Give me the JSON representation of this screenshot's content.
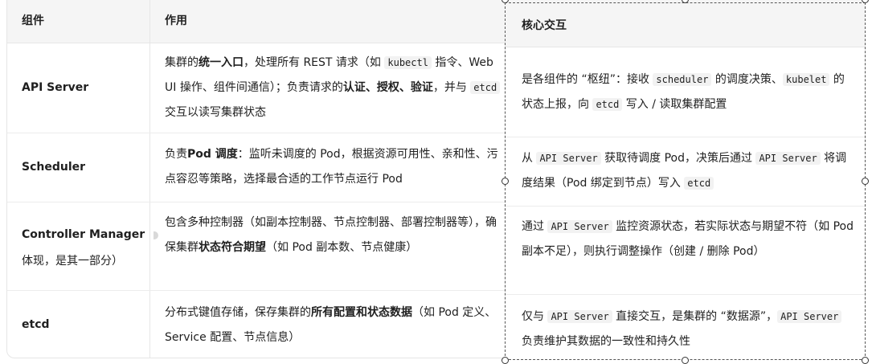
{
  "headers": {
    "component": "组件",
    "role": "作用",
    "interaction": "核心交互"
  },
  "rows": [
    {
      "name": "API Server",
      "desc": [
        {
          "t": "集群的"
        },
        {
          "b": "统一入口"
        },
        {
          "t": "，处理所有 REST 请求（如 "
        },
        {
          "c": "kubectl"
        },
        {
          "t": " 指令、Web UI 操作、组件间通信）；负责请求的"
        },
        {
          "b": "认证、授权、验证"
        },
        {
          "t": "，并与 "
        },
        {
          "c": "etcd"
        },
        {
          "t": " 交互以读写集群状态"
        }
      ],
      "interaction": [
        {
          "t": "是各组件的 “枢纽”：接收 "
        },
        {
          "c": "scheduler"
        },
        {
          "t": " 的调度决策、"
        },
        {
          "c": "kubelet"
        },
        {
          "t": " 的状态上报，向 "
        },
        {
          "c": "etcd"
        },
        {
          "t": " 写入 / 读取集群配置"
        }
      ]
    },
    {
      "name": "Scheduler",
      "desc": [
        {
          "t": "负责"
        },
        {
          "b": "Pod 调度"
        },
        {
          "t": "：监听未调度的 Pod，根据资源可用性、亲和性、污点容忍等策略，选择最合适的工作节点运行 Pod"
        }
      ],
      "interaction": [
        {
          "t": "从 "
        },
        {
          "c": "API Server"
        },
        {
          "t": " 获取待调度 Pod，决策后通过 "
        },
        {
          "c": "API Server"
        },
        {
          "t": " 将调度结果（Pod 绑定到节点）写入 "
        },
        {
          "c": "etcd"
        }
      ]
    },
    {
      "name": "Controller Manager",
      "sub": "体现，是其一部分）",
      "desc": [
        {
          "t": "包含多种控制器（如副本控制器、节点控制器、部署控制器等），确保集群"
        },
        {
          "b": "状态符合期望"
        },
        {
          "t": "（如 Pod 副本数、节点健康）"
        }
      ],
      "interaction": [
        {
          "t": "通过 "
        },
        {
          "c": "API Server"
        },
        {
          "t": " 监控资源状态，若实际状态与期望不符（如 Pod 副本不足），则执行调整操作（创建 / 删除 Pod）"
        }
      ]
    },
    {
      "name": "etcd",
      "desc": [
        {
          "t": "分布式键值存储，保存集群的"
        },
        {
          "b": "所有配置和状态数据"
        },
        {
          "t": "（如 Pod 定义、Service 配置、节点信息）"
        }
      ],
      "interaction": [
        {
          "t": "仅与 "
        },
        {
          "c": "API Server"
        },
        {
          "t": " 直接交互，是集群的 “数据源”，"
        },
        {
          "c": "API Server"
        },
        {
          "t": " 负责维护其数据的一致性和持久性"
        }
      ]
    }
  ]
}
